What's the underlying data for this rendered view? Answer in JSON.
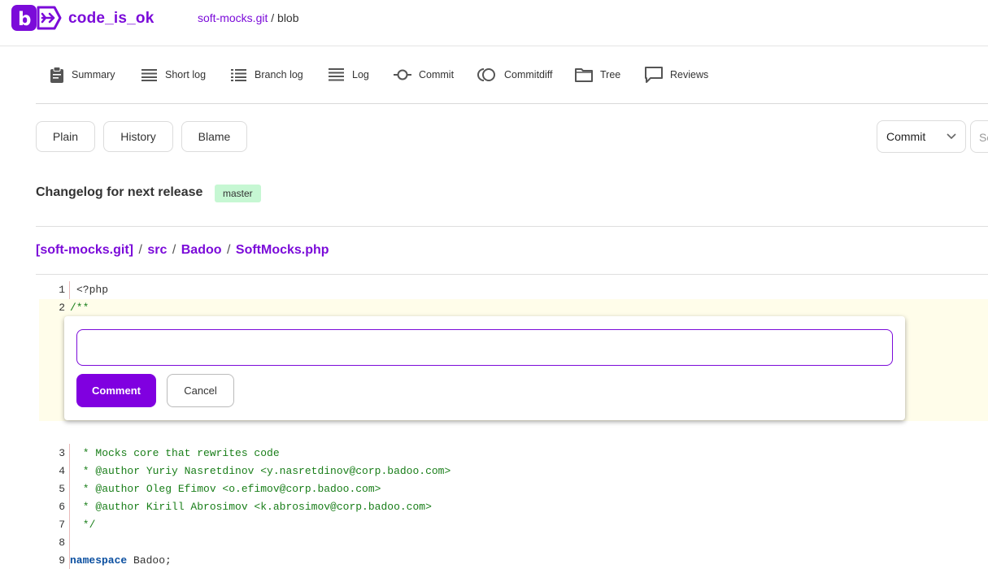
{
  "brand": {
    "name": "code_is_ok",
    "logo_icon": "badoo-logo-icon"
  },
  "breadcrumb": {
    "repo": "soft-mocks.git",
    "separator": "/",
    "page": "blob"
  },
  "nav": [
    {
      "label": "Summary",
      "icon": "clipboard-icon"
    },
    {
      "label": "Short log",
      "icon": "short-log-icon"
    },
    {
      "label": "Branch log",
      "icon": "branch-log-icon"
    },
    {
      "label": "Log",
      "icon": "log-icon"
    },
    {
      "label": "Commit",
      "icon": "commit-icon"
    },
    {
      "label": "Commitdiff",
      "icon": "commitdiff-icon"
    },
    {
      "label": "Tree",
      "icon": "folder-icon"
    },
    {
      "label": "Reviews",
      "icon": "speech-bubble-icon"
    }
  ],
  "view_buttons": {
    "plain": "Plain",
    "history": "History",
    "blame": "Blame"
  },
  "search_select": {
    "value": "Commit",
    "input_partial": "Se"
  },
  "commit": {
    "title": "Changelog for next release",
    "branch": "master"
  },
  "file_path": {
    "repo": "[soft-mocks.git]",
    "parts": [
      "src",
      "Badoo",
      "SoftMocks.php"
    ],
    "separator": "/"
  },
  "code_lines": [
    {
      "n": "1",
      "text": "<?php"
    },
    {
      "n": "2",
      "text": "/**"
    },
    {
      "n": "3",
      "text": " * Mocks core that rewrites code"
    },
    {
      "n": "4",
      "text": " * @author Yuriy Nasretdinov <y.nasretdinov@corp.badoo.com>"
    },
    {
      "n": "5",
      "text": " * @author Oleg Efimov <o.efimov@corp.badoo.com>"
    },
    {
      "n": "6",
      "text": " * @author Kirill Abrosimov <k.abrosimov@corp.badoo.com>"
    },
    {
      "n": "7",
      "text": " */"
    },
    {
      "n": "8",
      "text": ""
    },
    {
      "n": "9",
      "keyword": "namespace",
      "rest": " Badoo;"
    }
  ],
  "comment_box": {
    "value": "",
    "submit_label": "Comment",
    "cancel_label": "Cancel"
  },
  "colors": {
    "accent": "#7b0bd9",
    "button": "#8000e0",
    "badge_bg": "#c6f7d3",
    "highlight": "#fffdea",
    "comment_code": "#197e19"
  }
}
